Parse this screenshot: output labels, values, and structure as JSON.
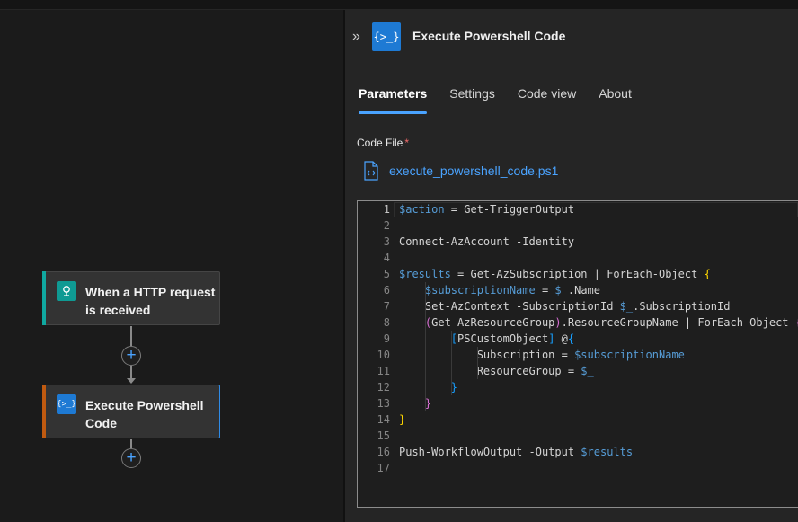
{
  "canvas": {
    "trigger_node": {
      "title": "When a HTTP request is received",
      "accent": "#10a8a0",
      "icon": "http-request-icon"
    },
    "action_node": {
      "title": "Execute Powershell Code",
      "accent": "#c05a10",
      "icon": "powershell-code-icon",
      "selected": true
    },
    "add_step_symbol": "+"
  },
  "panel": {
    "collapse_symbol": "»",
    "title": "Execute Powershell Code",
    "icon_text": "{>_}",
    "tabs": [
      {
        "label": "Parameters",
        "active": true
      },
      {
        "label": "Settings",
        "active": false
      },
      {
        "label": "Code view",
        "active": false
      },
      {
        "label": "About",
        "active": false
      }
    ],
    "code_file_label": "Code File",
    "required_mark": "*",
    "file_name": "execute_powershell_code.ps1"
  },
  "editor": {
    "lines": [
      [
        [
          "$action",
          "var"
        ],
        [
          " = Get-TriggerOutput",
          "def"
        ]
      ],
      [],
      [
        [
          "Connect-AzAccount -Identity",
          "def"
        ]
      ],
      [],
      [
        [
          "$results",
          "var"
        ],
        [
          " = Get-AzSubscription | ForEach-Object ",
          "def"
        ],
        [
          "{",
          "y"
        ]
      ],
      [
        [
          "    ",
          "def"
        ],
        [
          "$subscriptionName",
          "var"
        ],
        [
          " = ",
          "def"
        ],
        [
          "$_",
          "var"
        ],
        [
          ".Name",
          "def"
        ]
      ],
      [
        [
          "    Set-AzContext -SubscriptionId ",
          "def"
        ],
        [
          "$_",
          "var"
        ],
        [
          ".SubscriptionId",
          "def"
        ]
      ],
      [
        [
          "    ",
          "def"
        ],
        [
          "(",
          "p"
        ],
        [
          "Get-AzResourceGroup",
          "def"
        ],
        [
          ")",
          "p"
        ],
        [
          ".ResourceGroupName | ForEach-Object ",
          "def"
        ],
        [
          "{",
          "p"
        ]
      ],
      [
        [
          "        ",
          "def"
        ],
        [
          "[",
          "b"
        ],
        [
          "PSCustomObject",
          "def"
        ],
        [
          "]",
          "b"
        ],
        [
          " @",
          "def"
        ],
        [
          "{",
          "b"
        ]
      ],
      [
        [
          "            Subscription = ",
          "def"
        ],
        [
          "$subscriptionName",
          "var"
        ]
      ],
      [
        [
          "            ResourceGroup = ",
          "def"
        ],
        [
          "$_",
          "var"
        ]
      ],
      [
        [
          "        ",
          "def"
        ],
        [
          "}",
          "b"
        ]
      ],
      [
        [
          "    ",
          "def"
        ],
        [
          "}",
          "p"
        ]
      ],
      [
        [
          "}",
          "y"
        ]
      ],
      [],
      [
        [
          "Push-WorkflowOutput -Output ",
          "def"
        ],
        [
          "$results",
          "var"
        ]
      ],
      []
    ]
  }
}
